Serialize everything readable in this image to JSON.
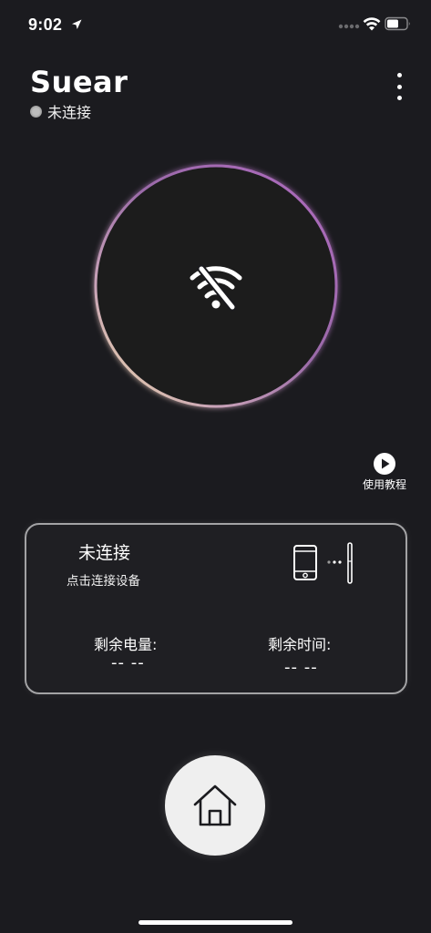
{
  "status_bar": {
    "time": "9:02",
    "icons": [
      "location-arrow-icon",
      "signal-icon",
      "wifi-icon",
      "battery-icon"
    ]
  },
  "header": {
    "app_name": "Suear",
    "connection_status": "未连接",
    "menu_icon": "more-vertical-icon"
  },
  "connection_ring": {
    "icon": "wifi-off-icon"
  },
  "tutorial": {
    "label": "使用教程",
    "icon": "play-icon"
  },
  "device_card": {
    "title": "未连接",
    "subtitle": "点击连接设备",
    "battery_label": "剩余电量:",
    "battery_value": "-- --",
    "time_label": "剩余时间:",
    "time_value": "-- --",
    "graphic_icons": [
      "phone-icon",
      "earpick-device-icon"
    ]
  },
  "bottom_nav": {
    "home_icon": "home-icon"
  },
  "colors": {
    "background": "#1b1b1f",
    "ring_gradient": [
      "#c47fc8",
      "#9a5fb0",
      "#e6d9a8"
    ],
    "card_border": "#a3a3a5",
    "home_button": "#efefef"
  }
}
